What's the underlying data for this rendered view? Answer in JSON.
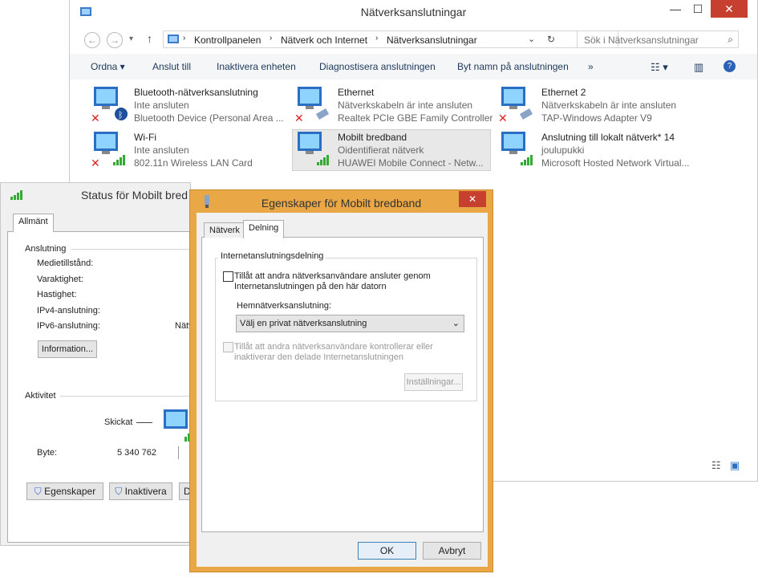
{
  "explorer": {
    "title": "Nätverksanslutningar",
    "breadcrumb": [
      "Kontrollpanelen",
      "Nätverk och Internet",
      "Nätverksanslutningar"
    ],
    "search_placeholder": "Sök i Nätverksanslutningar",
    "toolbar": [
      "Ordna ▾",
      "Anslut till",
      "Inaktivera enheten",
      "Diagnostisera anslutningen",
      "Byt namn på anslutningen",
      "»"
    ],
    "connections": [
      {
        "name": "Bluetooth-nätverksanslutning",
        "status": "Inte ansluten",
        "device": "Bluetooth Device (Personal Area ..."
      },
      {
        "name": "Ethernet",
        "status": "Nätverkskabeln är inte ansluten",
        "device": "Realtek PCIe GBE Family Controller"
      },
      {
        "name": "Ethernet 2",
        "status": "Nätverkskabeln är inte ansluten",
        "device": "TAP-Windows Adapter V9"
      },
      {
        "name": "Wi-Fi",
        "status": "Inte ansluten",
        "device": "802.11n Wireless LAN Card"
      },
      {
        "name": "Mobilt bredband",
        "status": "Oidentifierat nätverk",
        "device": "HUAWEI Mobile Connect - Netw..."
      },
      {
        "name": "Anslutning till lokalt nätverk* 14",
        "status": "joulupukki",
        "device": "Microsoft Hosted Network Virtual..."
      }
    ]
  },
  "status_dialog": {
    "title": "Status för Mobilt bred",
    "tab": "Allmänt",
    "connection_heading": "Anslutning",
    "rows": [
      "Medietillstånd:",
      "Varaktighet:",
      "Hastighet:",
      "IPv4-anslutning:",
      "IPv6-anslutning:"
    ],
    "ipv6_value": "Nätv",
    "info_button": "Information...",
    "activity_heading": "Aktivitet",
    "sent_label": "Skickat",
    "bytes_label": "Byte:",
    "bytes_value": "5 340 762",
    "props_button": "Egenskaper",
    "disable_button": "Inaktivera",
    "diag_button": "Di"
  },
  "props_dialog": {
    "title": "Egenskaper för Mobilt bredband",
    "tabs": [
      "Nätverk",
      "Delning"
    ],
    "group_title": "Internetanslutningsdelning",
    "allow_checkbox": "Tillåt att andra nätverksanvändare ansluter genom Internetanslutningen på den här datorn",
    "home_label": "Hemnätverksanslutning:",
    "home_select": "Välj en privat nätverksanslutning",
    "control_checkbox": "Tillåt att andra nätverksanvändare kontrollerar eller inaktiverar den delade Internetanslutningen",
    "settings_button": "Inställningar...",
    "ok_button": "OK",
    "cancel_button": "Avbryt"
  }
}
